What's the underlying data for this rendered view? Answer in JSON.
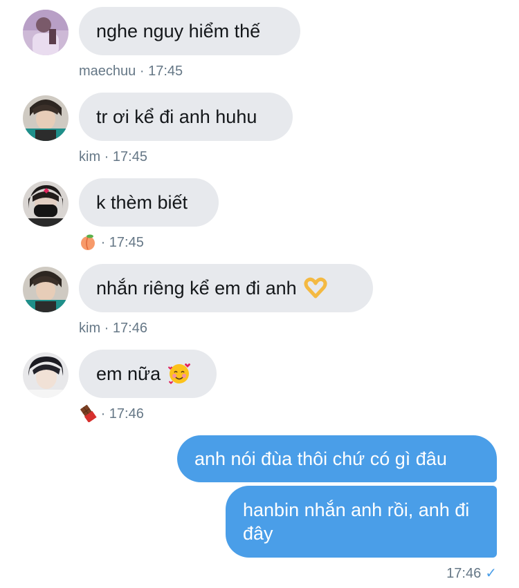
{
  "colors": {
    "incoming_bubble": "#e7e9ed",
    "outgoing_bubble": "#4a9ee8",
    "meta_text": "#657786",
    "read_check": "#4a9ee8"
  },
  "messages_in": [
    {
      "text": "nghe nguy hiểm thế",
      "sender": "maechuu",
      "time": "17:45",
      "avatar": "avatar-maechuu"
    },
    {
      "text": "tr ơi kể đi anh huhu",
      "sender": "kim",
      "time": "17:45",
      "avatar": "avatar-kim"
    },
    {
      "text": "k thèm biết",
      "sender_icon": "peach-emoji",
      "time": "17:45",
      "avatar": "avatar-masked"
    },
    {
      "text": "nhắn riêng kể em đi anh",
      "text_emoji": "heart-hands-emoji",
      "sender": "kim",
      "time": "17:46",
      "avatar": "avatar-kim"
    },
    {
      "text": "em nữa",
      "text_emoji": "smiling-face-with-hearts-emoji",
      "sender_icon": "chocolate-bar-emoji",
      "time": "17:46",
      "avatar": "avatar-dark-hair"
    }
  ],
  "messages_out": [
    {
      "text": "anh nói đùa thôi chứ có gì đâu"
    },
    {
      "text": "hanbin nhắn anh rồi, anh đi đây"
    }
  ],
  "out_meta": {
    "time": "17:46",
    "status_icon": "read-check-icon",
    "status_glyph": "✓"
  },
  "separator": "·"
}
